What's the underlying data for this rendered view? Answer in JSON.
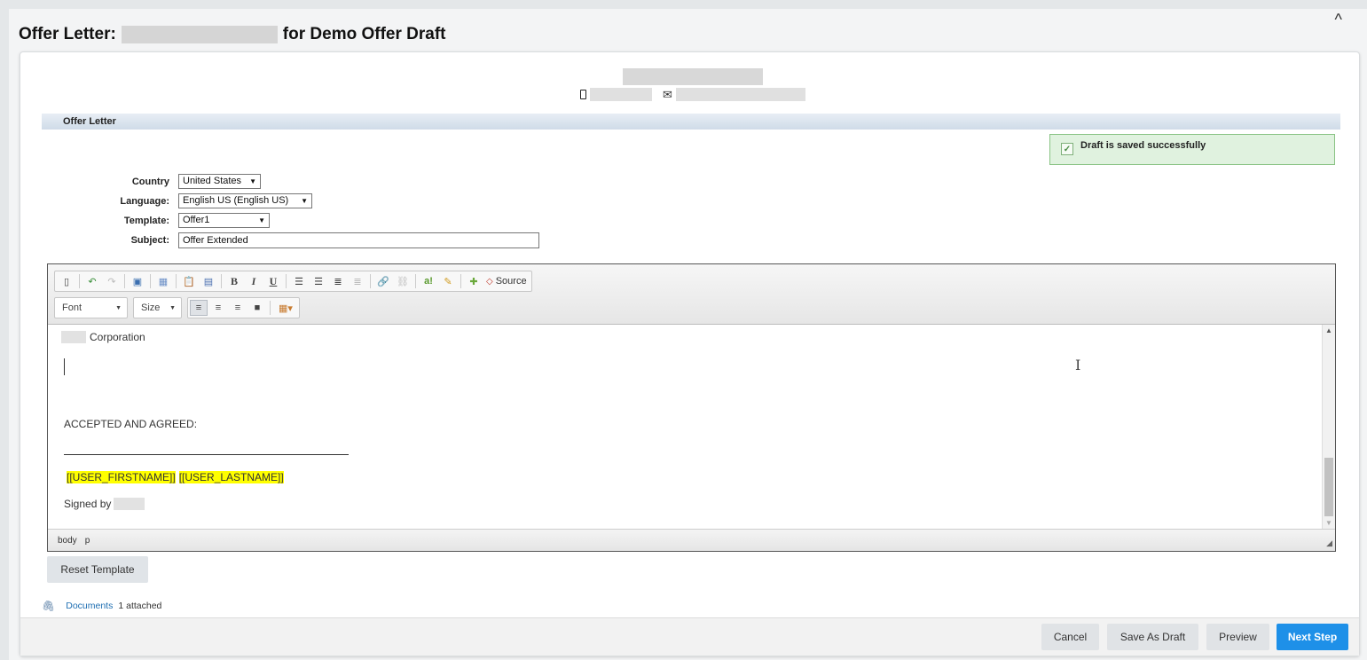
{
  "header": {
    "title_prefix": "Offer Letter:",
    "title_suffix": "for Demo Offer Draft",
    "collapse_glyph": "^"
  },
  "section": {
    "title": "Offer Letter"
  },
  "alert": {
    "message": "Draft is saved successfully",
    "icon": "check-icon"
  },
  "form": {
    "country_label": "Country",
    "country_value": "United States",
    "language_label": "Language:",
    "language_value": "English US (English US)",
    "template_label": "Template:",
    "template_value": "Offer1",
    "subject_label": "Subject:",
    "subject_value": "Offer Extended"
  },
  "toolbar": {
    "font_label": "Font",
    "size_label": "Size",
    "source_label": "Source",
    "bold_glyph": "B",
    "italic_glyph": "I",
    "underline_glyph": "U"
  },
  "editor": {
    "corporation_text": "Corporation",
    "accepted_text": "ACCEPTED AND AGREED:",
    "merge_firstname": "[[USER_FIRSTNAME]]",
    "merge_lastname": "[[USER_LASTNAME]]",
    "signed_by": "Signed by",
    "path": [
      "body",
      "p"
    ]
  },
  "actions": {
    "reset_template": "Reset Template",
    "documents_link": "Documents",
    "documents_count": "1 attached",
    "cancel": "Cancel",
    "save_as_draft": "Save As Draft",
    "preview": "Preview",
    "next_step": "Next Step"
  },
  "colors": {
    "primary": "#1e90e8",
    "highlight": "#ffff00",
    "success_bg": "#e0f2df",
    "success_border": "#89c384"
  }
}
